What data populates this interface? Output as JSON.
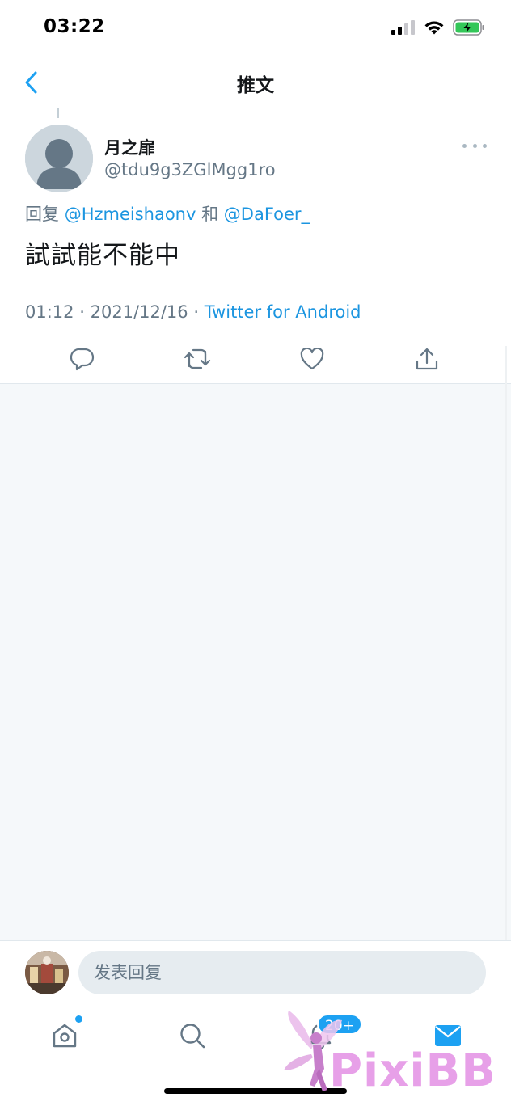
{
  "status_bar": {
    "time": "03:22",
    "icons": [
      "signal-icon",
      "wifi-icon",
      "battery-charging-icon"
    ]
  },
  "navbar": {
    "back_icon": "chevron-left-icon",
    "title": "推文"
  },
  "tweet": {
    "display_name": "月之扉",
    "handle": "@tdu9g3ZGlMgg1ro",
    "reply_prefix": "回复",
    "reply_to": [
      "@Hzmeishaonv",
      "@DaFoer_"
    ],
    "reply_joiner": "和",
    "text": "試試能不能中",
    "time": "01:12",
    "date": "2021/12/16",
    "separator": "·",
    "source": "Twitter for Android",
    "actions": [
      "reply-icon",
      "retweet-icon",
      "like-icon",
      "share-icon"
    ]
  },
  "reply_bar": {
    "placeholder": "发表回复"
  },
  "tabbar": {
    "tabs": [
      "home-icon",
      "search-icon",
      "notifications-icon",
      "messages-icon"
    ],
    "notifications_badge": "20+"
  },
  "watermark": {
    "text": "PixiBB"
  },
  "colors": {
    "accent": "#1da1f2",
    "link": "#1b95e0",
    "muted": "#657786",
    "background_empty": "#f5f8fa",
    "divider": "#e1e8ed"
  }
}
